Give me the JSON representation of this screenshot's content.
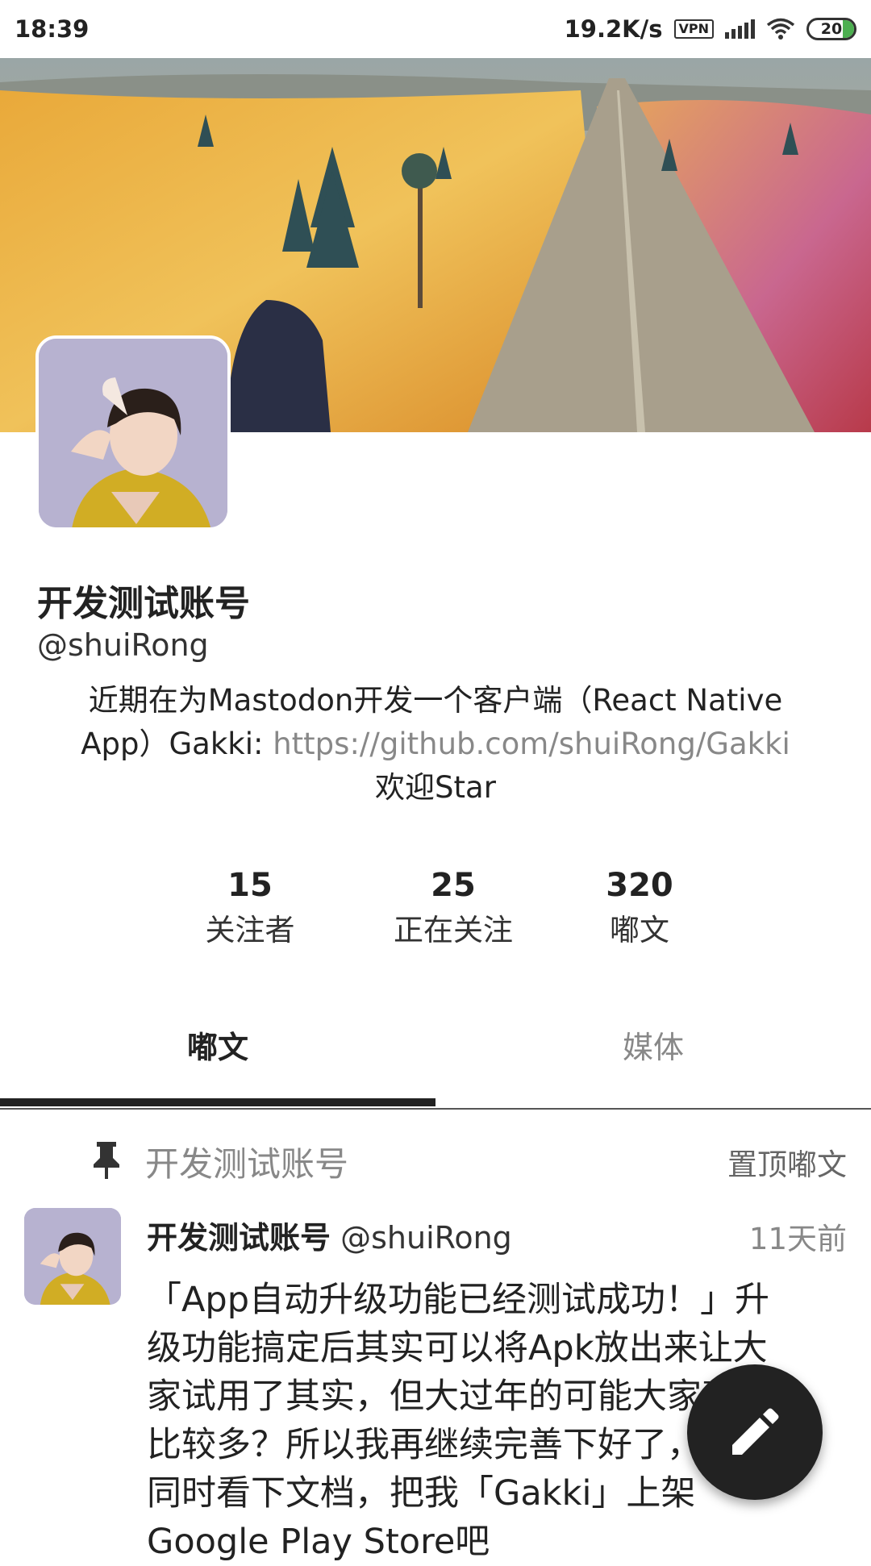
{
  "status_bar": {
    "time": "18:39",
    "net_speed": "19.2K/s",
    "vpn": "VPN",
    "battery": "20"
  },
  "profile": {
    "display_name": "开发测试账号",
    "handle": "@shuiRong",
    "bio_prefix": "近期在为Mastodon开发一个客户端（React Native App）Gakki: ",
    "bio_link": "https://github.com/shuiRong/Gakki",
    "bio_suffix": "欢迎Star"
  },
  "stats": [
    {
      "value": "15",
      "label": "关注者"
    },
    {
      "value": "25",
      "label": "正在关注"
    },
    {
      "value": "320",
      "label": "嘟文"
    }
  ],
  "tabs": [
    {
      "label": "嘟文",
      "active": true
    },
    {
      "label": "媒体",
      "active": false
    }
  ],
  "pinned": {
    "account_name": "开发测试账号",
    "tag": "置顶嘟文"
  },
  "post": {
    "name": "开发测试账号",
    "handle": "@shuiRong",
    "time": "11天前",
    "body": "「App自动升级功能已经测试成功！」升级功能搞定后其实可以将Apk放出来让大家试用了其实，但大过年的可能大家事情比较多？所以我再继续完善下好了，然后同时看下文档，把我「Gakki」上架Google Play Store吧"
  },
  "icons": {
    "pin": "pin-icon",
    "compose": "pencil-icon",
    "wifi": "wifi-icon",
    "signal": "signal-icon",
    "battery": "battery-icon"
  }
}
